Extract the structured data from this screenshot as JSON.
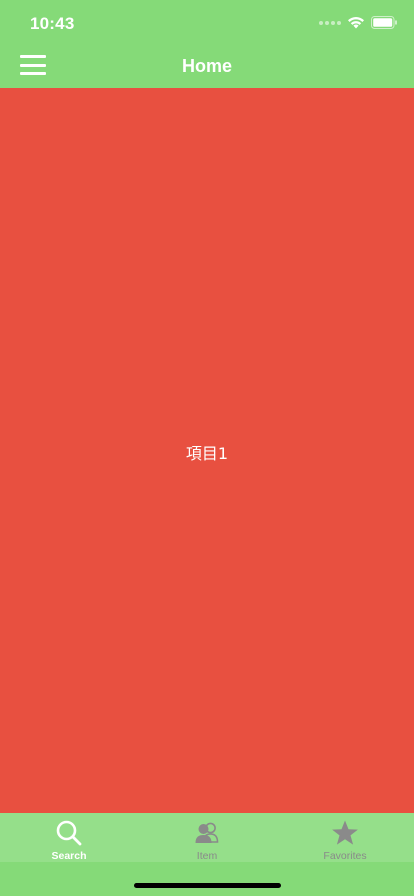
{
  "status_bar": {
    "time": "10:43"
  },
  "nav": {
    "title": "Home"
  },
  "content": {
    "label": "項目1"
  },
  "tabs": [
    {
      "label": "Search",
      "icon": "search-icon",
      "active": true
    },
    {
      "label": "Item",
      "icon": "contacts-icon",
      "active": false
    },
    {
      "label": "Favorites",
      "icon": "star-icon",
      "active": false
    }
  ],
  "colors": {
    "bar_green": "#85da78",
    "tab_bar_green": "#95df8a",
    "content_red": "#e85040",
    "active_tab": "#ffffff",
    "inactive_tab": "#8a8a8a"
  }
}
